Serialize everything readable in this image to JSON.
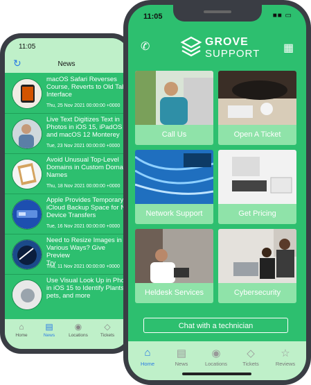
{
  "back_phone": {
    "status_time": "11:05",
    "nav_title": "News",
    "refresh_icon": "refresh-icon",
    "news": [
      {
        "headline": "macOS Safari Reverses\nCourse, Reverts to Old Tab\nInterface",
        "date": "Thu, 25 Nov 2021 00:00:00 +0000"
      },
      {
        "headline": "Live Text Digitizes Text in\nPhotos in iOS 15, iPadOS 1\nand macOS 12 Monterey",
        "date": "Tue, 23 Nov 2021 00:00:00 +0000"
      },
      {
        "headline": "Avoid Unusual Top-Level\nDomains in Custom Domai\nNames",
        "date": "Thu, 18 Nov 2021 00:00:00 +0000"
      },
      {
        "headline": "Apple Provides Temporary\niCloud Backup Space for N\nDevice Transfers",
        "date": "Tue, 16 Nov 2021 00:00:00 +0000"
      },
      {
        "headline": "Need to Resize Images in\nVarious Ways? Give Preview\nTry",
        "date": "Thu, 11 Nov 2021 00:00:00 +0000"
      },
      {
        "headline": "Use Visual Look Up in Phot\nin iOS 15 to Identify Plants,\npets, and more",
        "date": ""
      }
    ],
    "tabs": [
      {
        "label": "Home",
        "icon": "home-icon"
      },
      {
        "label": "News",
        "icon": "news-icon"
      },
      {
        "label": "Locations",
        "icon": "location-pin-icon"
      },
      {
        "label": "Tickets",
        "icon": "ticket-icon"
      }
    ]
  },
  "front_phone": {
    "status_time": "11:05",
    "brand": {
      "line1": "GROVE",
      "line2": "SUPPORT"
    },
    "tiles": [
      {
        "label": "Call Us"
      },
      {
        "label": "Open A Ticket"
      },
      {
        "label": "Network Support"
      },
      {
        "label": "Get Pricing"
      },
      {
        "label": "Heldesk Services"
      },
      {
        "label": "Cybersecurity"
      }
    ],
    "chat_button": "Chat with a technician",
    "tabs": [
      {
        "label": "Home",
        "icon": "home-icon"
      },
      {
        "label": "News",
        "icon": "news-icon"
      },
      {
        "label": "Locations",
        "icon": "location-pin-icon"
      },
      {
        "label": "Tickets",
        "icon": "ticket-icon"
      },
      {
        "label": "Reviews",
        "icon": "star-icon"
      }
    ]
  },
  "colors": {
    "brand_green": "#2dbf6f",
    "light_green": "#bff0c9",
    "active_blue": "#2a7be4"
  }
}
